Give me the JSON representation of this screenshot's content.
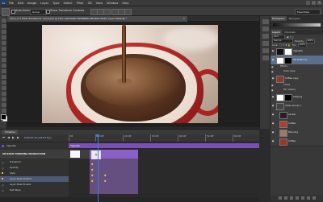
{
  "app": {
    "logo_text": "Ps",
    "menus": [
      "File",
      "Edit",
      "Image",
      "Layer",
      "Type",
      "Select",
      "Filter",
      "3D",
      "View",
      "Window",
      "Help"
    ],
    "window_buttons": [
      "–",
      "□",
      "✕"
    ]
  },
  "options_bar": {
    "auto_select_label": "Auto-Select:",
    "auto_select_value": "Group",
    "show_transform_label": "Show Transform Controls",
    "workspace": "Essentials"
  },
  "document": {
    "tab_title": "ution_2.4 Slide Transitions: Save.psd @ 25% (AN EARLY MORNING PRODUCTION, Layer Mask/8) *",
    "close": "✕"
  },
  "panels": {
    "top_tabs": [
      "Histogram",
      "Navigator"
    ],
    "layer_tabs": [
      "Layers",
      "Channels"
    ],
    "kind_label": "Kind",
    "blend_mode": "Normal",
    "opacity_label": "Opacity:",
    "opacity_value": "100%",
    "lock_label": "Lock:",
    "fill_label": "Fill:",
    "fill_value": "100%",
    "layers": [
      {
        "name": "Vignette",
        "thumb": "#111111",
        "selected": false
      },
      {
        "name": "AN EARLY M…",
        "thumb": "#ffffff",
        "selected": true
      },
      {
        "name": "Effects",
        "sub": true
      },
      {
        "name": "Outer Glow",
        "sub": true
      },
      {
        "name": "Coffee copy",
        "thumb": "#8a3a2a",
        "selected": false
      },
      {
        "name": "Levels",
        "sub": true
      },
      {
        "name": "Blur Gallery",
        "sub": true
      },
      {
        "name": "Clipping",
        "thumb": "#ffffff",
        "selected": false
      },
      {
        "name": "Video Group 1",
        "thumb": "#444444",
        "selected": false
      },
      {
        "name": "Levels",
        "thumb": "#222222",
        "selected": false
      },
      {
        "name": "Coffee",
        "thumb": "#b43c2e",
        "selected": false
      },
      {
        "name": "Planning",
        "thumb": "#9a7a6a",
        "selected": false
      },
      {
        "name": "Coffee",
        "thumb": "#a33326",
        "selected": false
      }
    ]
  },
  "timeline": {
    "tab_label": "Timeline",
    "timecode": "0;00;07;10 (29.97 fps)",
    "ruler_labels": [
      "00",
      "10:00f",
      "20:00f",
      "30:00f",
      "40:00f",
      "50:00f",
      "60:00f"
    ],
    "rows": [
      {
        "label": "Vignette",
        "kind": "layer"
      },
      {
        "label": "AN EARLY MORNING PRODUCTION",
        "kind": "main"
      },
      {
        "label": "Transform",
        "kind": "prop"
      },
      {
        "label": "Opacity",
        "kind": "prop"
      },
      {
        "label": "Style",
        "kind": "prop"
      },
      {
        "label": "Layer Mask Position",
        "kind": "hl"
      },
      {
        "label": "Layer Mask Enable",
        "kind": "prop"
      },
      {
        "label": "Text Warp",
        "kind": "prop"
      }
    ],
    "vignette_clip": "Vignette",
    "clip_glyph": "A"
  }
}
